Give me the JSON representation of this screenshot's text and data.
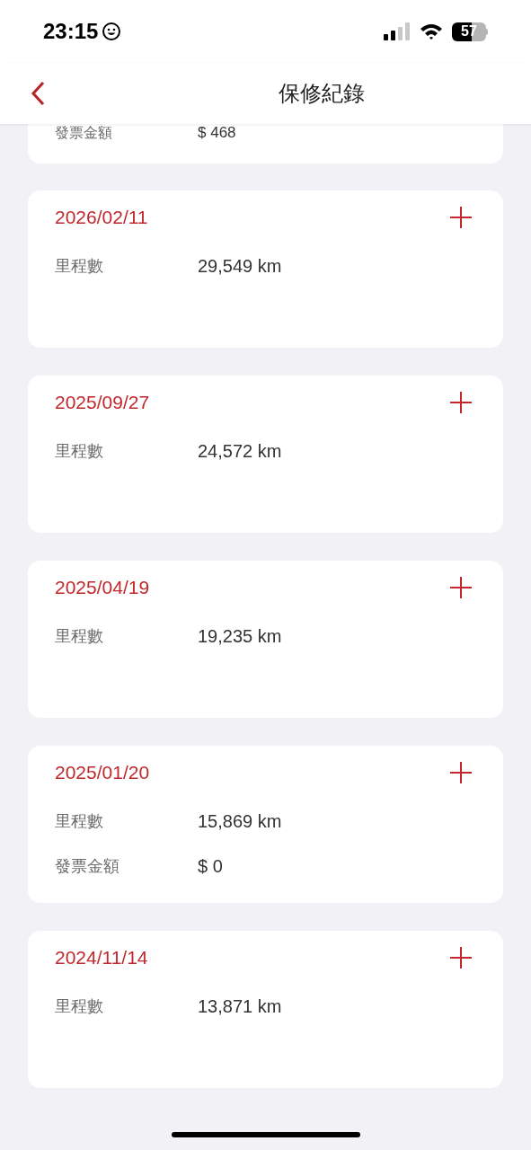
{
  "status_bar": {
    "time": "23:15",
    "battery": "57"
  },
  "header": {
    "title": "保修紀錄"
  },
  "partial_record": {
    "rows": [
      {
        "label": "發票金額",
        "value": "$ 468"
      }
    ]
  },
  "records": [
    {
      "date": "2026/02/11",
      "rows": [
        {
          "label": "里程數",
          "value": "29,549 km"
        }
      ]
    },
    {
      "date": "2025/09/27",
      "rows": [
        {
          "label": "里程數",
          "value": "24,572 km"
        }
      ]
    },
    {
      "date": "2025/04/19",
      "rows": [
        {
          "label": "里程數",
          "value": "19,235 km"
        }
      ]
    },
    {
      "date": "2025/01/20",
      "rows": [
        {
          "label": "里程數",
          "value": "15,869 km"
        },
        {
          "label": "發票金額",
          "value": "$ 0"
        }
      ]
    },
    {
      "date": "2024/11/14",
      "rows": [
        {
          "label": "里程數",
          "value": "13,871 km"
        }
      ]
    }
  ]
}
